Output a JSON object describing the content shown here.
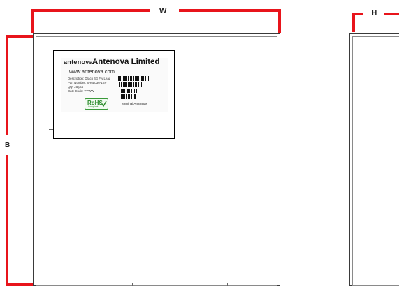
{
  "dimensions": {
    "width_label": "W",
    "height_label": "B",
    "depth_label": "H"
  },
  "label": {
    "brand_small": "antenova",
    "company": "Antenova Limited",
    "website": "www.antenova.com",
    "lines": [
      "Description: Draco 4G Fly Lead",
      "Part Number: SR6L036-1SP",
      "Qty: 25 pcs",
      "Date Code: YYWW"
    ],
    "rohs": "RoHS",
    "rohs_sub": "Compliant",
    "product_type": "Terminal Antennas"
  },
  "colors": {
    "dimension_line": "#e8141b",
    "box_outline": "#3a3a3a"
  }
}
